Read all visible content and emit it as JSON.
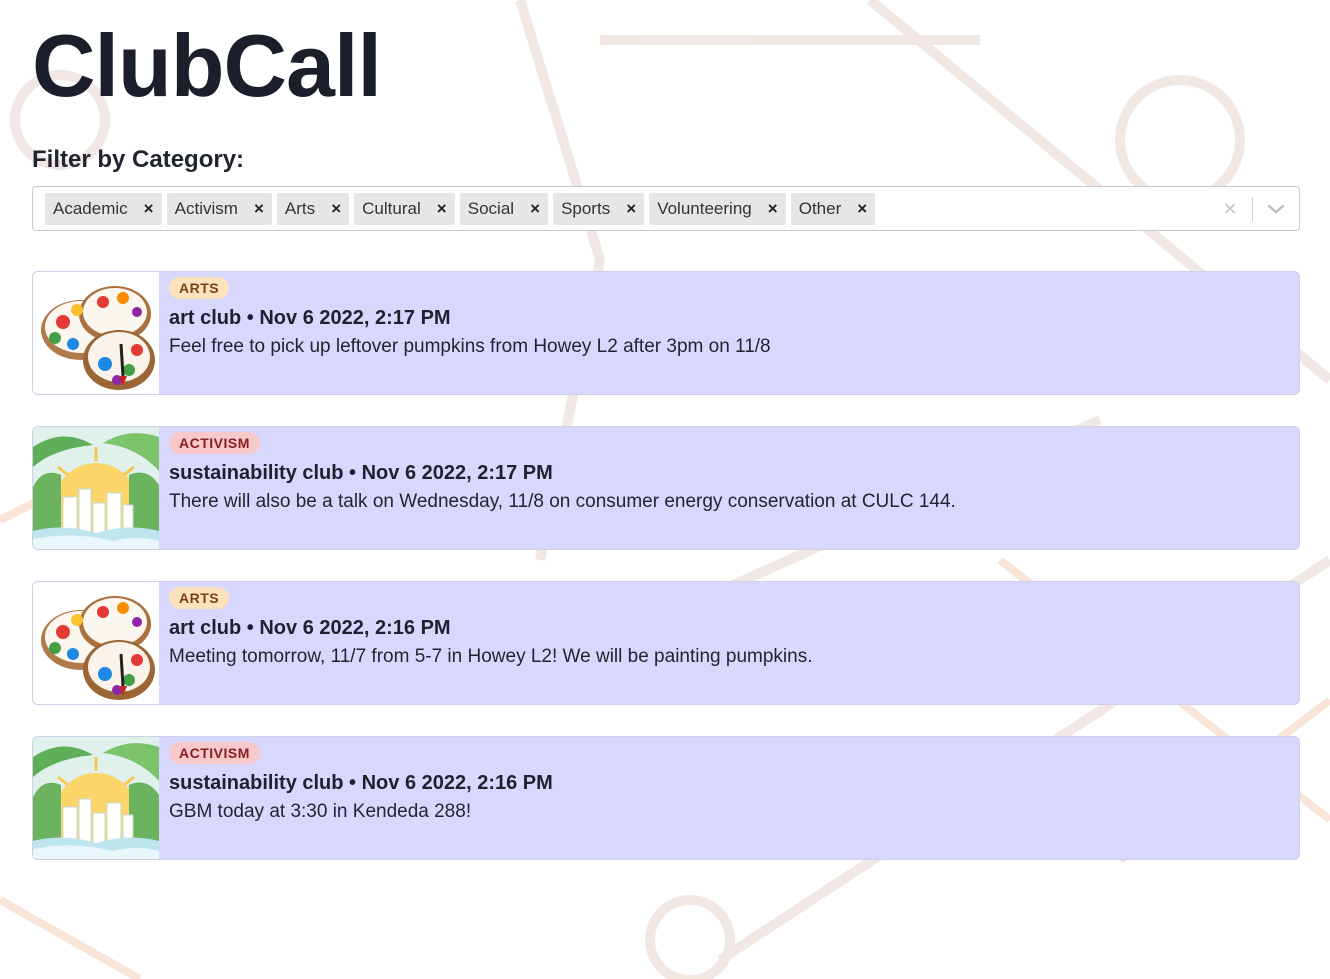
{
  "app": {
    "title": "ClubCall"
  },
  "filter": {
    "label": "Filter by Category:",
    "chips": [
      "Academic",
      "Activism",
      "Arts",
      "Cultural",
      "Social",
      "Sports",
      "Volunteering",
      "Other"
    ],
    "remove_glyph": "×",
    "clear_glyph": "×",
    "clear_icon": "clear-icon",
    "dropdown_icon": "chevron-down-icon"
  },
  "posts": [
    {
      "tag": "ARTS",
      "tag_kind": "arts",
      "meta": "art club • Nov 6 2022, 2:17 PM",
      "message": "Feel free to pick up leftover pumpkins from Howey L2 after 3pm on 11/8",
      "image": "paint-palette-image"
    },
    {
      "tag": "ACTIVISM",
      "tag_kind": "activism",
      "meta": "sustainability club • Nov 6 2022, 2:17 PM",
      "message": "There will also be a talk on Wednesday, 11/8 on consumer energy conservation at CULC 144.",
      "image": "green-city-image"
    },
    {
      "tag": "ARTS",
      "tag_kind": "arts",
      "meta": "art club • Nov 6 2022, 2:16 PM",
      "message": "Meeting tomorrow, 11/7 from 5-7 in Howey L2! We will be painting pumpkins.",
      "image": "paint-palette-image"
    },
    {
      "tag": "ACTIVISM",
      "tag_kind": "activism",
      "meta": "sustainability club • Nov 6 2022, 2:16 PM",
      "message": "GBM today at 3:30 in Kendeda 288!",
      "image": "green-city-image"
    }
  ],
  "colors": {
    "post_background": "#d8d7fd",
    "arts_tag": "#fde3bd",
    "activism_tag": "#f8c9cb"
  }
}
